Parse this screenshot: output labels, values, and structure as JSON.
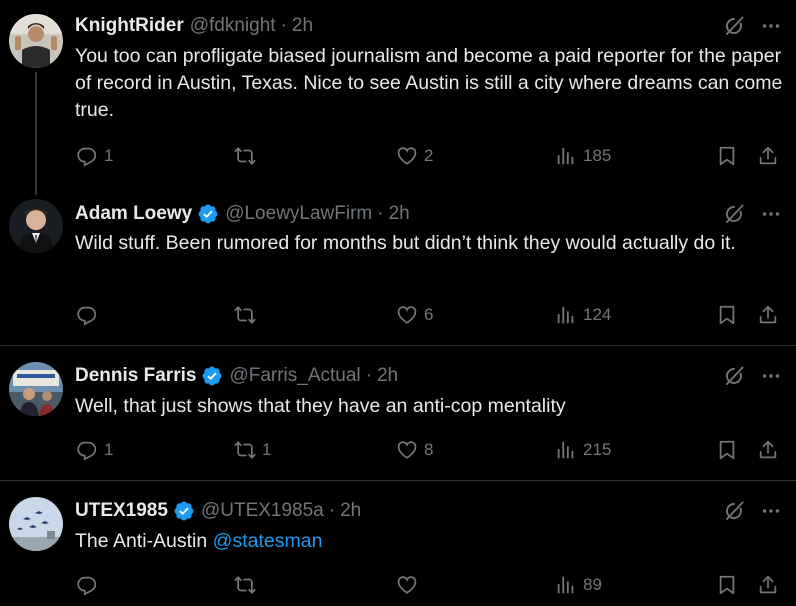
{
  "tweets": [
    {
      "name": "KnightRider",
      "handle": "@fdknight",
      "dot": "·",
      "time": "2h",
      "verified": false,
      "text": "You too can profligate biased journalism and become a paid reporter for the paper of record in Austin, Texas. Nice to see Austin is still a city where dreams can come true.",
      "replies": "1",
      "reposts": "",
      "likes": "2",
      "views": "185"
    },
    {
      "name": "Adam Loewy",
      "handle": "@LoewyLawFirm",
      "dot": "·",
      "time": "2h",
      "verified": true,
      "text": "Wild stuff. Been rumored for months but didn’t think they would actually do it.",
      "replies": "",
      "reposts": "",
      "likes": "6",
      "views": "124"
    },
    {
      "name": "Dennis Farris",
      "handle": "@Farris_Actual",
      "dot": "·",
      "time": "2h",
      "verified": true,
      "text": "Well, that just shows that they have an anti-cop mentality",
      "replies": "1",
      "reposts": "1",
      "likes": "8",
      "views": "215"
    },
    {
      "name": "UTEX1985",
      "handle": "@UTEX1985a",
      "dot": "·",
      "time": "2h",
      "verified": true,
      "text_prefix": "The Anti-Austin ",
      "mention": "@statesman",
      "replies": "",
      "reposts": "",
      "likes": "",
      "views": "89"
    }
  ],
  "colors": {
    "background": "#000000",
    "text": "#e7e9ea",
    "secondary": "#71767b",
    "link": "#1d9bf0",
    "verified": "#1d9bf0",
    "divider": "#2f3336"
  }
}
